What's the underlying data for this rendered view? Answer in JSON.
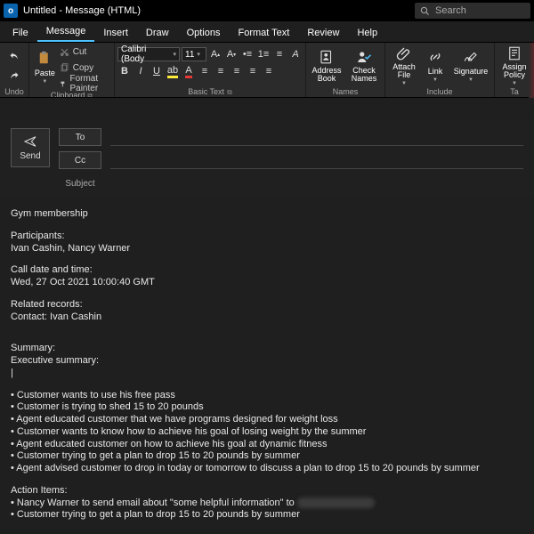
{
  "title": "Untitled  -  Message (HTML)",
  "search_placeholder": "Search",
  "menu": {
    "file": "File",
    "message": "Message",
    "insert": "Insert",
    "draw": "Draw",
    "options": "Options",
    "format_text": "Format Text",
    "review": "Review",
    "help": "Help"
  },
  "ribbon": {
    "undo_group": "Undo",
    "paste": "Paste",
    "cut": "Cut",
    "copy": "Copy",
    "format_painter": "Format Painter",
    "clipboard_group": "Clipboard",
    "font_name": "Calibri (Body",
    "font_size": "11",
    "basic_text_group": "Basic Text",
    "address_book": "Address Book",
    "check_names": "Check Names",
    "names_group": "Names",
    "attach_file": "Attach File",
    "link": "Link",
    "signature": "Signature",
    "include_group": "Include",
    "assign_policy": "Assign Policy",
    "tags_group": "Ta"
  },
  "compose": {
    "send": "Send",
    "to": "To",
    "cc": "Cc",
    "subject_label": "Subject"
  },
  "body": {
    "subject_line": "Gym membership",
    "participants_label": "Participants:",
    "participants": "Ivan Cashin, Nancy Warner",
    "datetime_label": "Call date and time:",
    "datetime": "Wed, 27 Oct 2021 10:00:40 GMT",
    "related_label": "Related records:",
    "related": "Contact: Ivan Cashin",
    "summary_label": "Summary:",
    "exec_label": "Executive summary:",
    "cursor": "|",
    "bullets": [
      "• Customer wants to use his free pass",
      "• Customer is trying to shed 15 to 20 pounds",
      "• Agent educated customer that we have programs designed for weight loss",
      "• Customer wants to know how to achieve his goal of losing weight by the summer",
      "• Agent educated customer on how to achieve his goal at dynamic fitness",
      "• Customer trying to get a plan to drop 15 to 20 pounds by summer",
      "• Agent advised customer to drop in today or tomorrow to discuss a plan to drop 15 to 20 pounds by summer"
    ],
    "action_label": "Action Items:",
    "action_1_pre": "• Nancy Warner to send email about \"some helpful information\" to ",
    "action_1_redacted": "+353892678274.",
    "action_2": "• Customer trying to get a plan to drop 15 to 20 pounds by summer"
  }
}
